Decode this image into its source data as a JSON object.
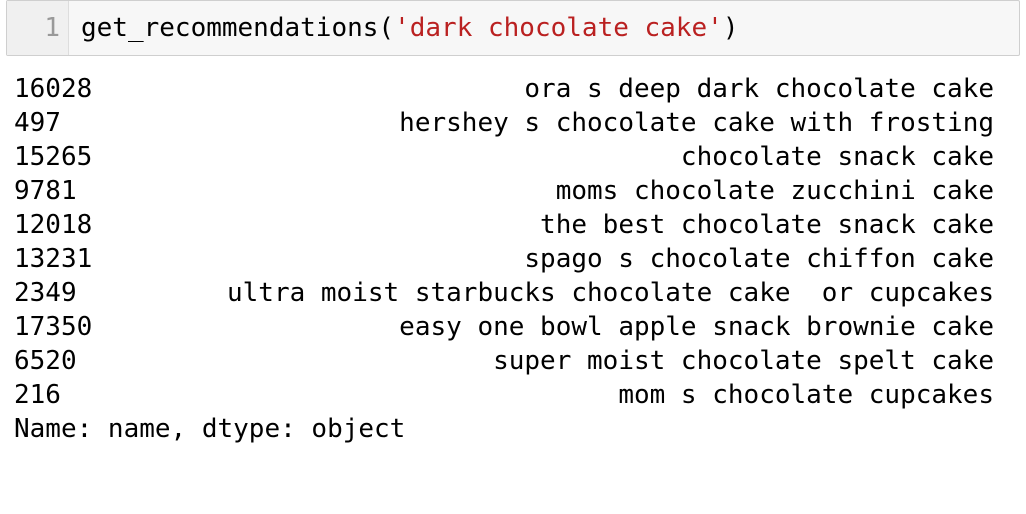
{
  "input_cell": {
    "line_number": "1",
    "code_func": "get_recommendations(",
    "code_string": "'dark chocolate cake'",
    "code_close": ")"
  },
  "output": {
    "rows": [
      {
        "index": "16028",
        "name": "ora s deep dark chocolate cake"
      },
      {
        "index": "497",
        "name": "hershey s chocolate cake with frosting"
      },
      {
        "index": "15265",
        "name": "chocolate snack cake"
      },
      {
        "index": "9781",
        "name": "moms chocolate zucchini cake"
      },
      {
        "index": "12018",
        "name": "the best chocolate snack cake"
      },
      {
        "index": "13231",
        "name": "spago s chocolate chiffon cake"
      },
      {
        "index": "2349",
        "name": "ultra moist starbucks chocolate cake  or cupcakes"
      },
      {
        "index": "17350",
        "name": "easy one bowl apple snack brownie cake"
      },
      {
        "index": "6520",
        "name": "super moist chocolate spelt cake"
      },
      {
        "index": "216",
        "name": "mom s chocolate cupcakes"
      }
    ],
    "footer": "Name: name, dtype: object"
  },
  "colors": {
    "string": "#ba2121",
    "cell_background": "#f7f7f7",
    "gutter_text": "#999999"
  }
}
